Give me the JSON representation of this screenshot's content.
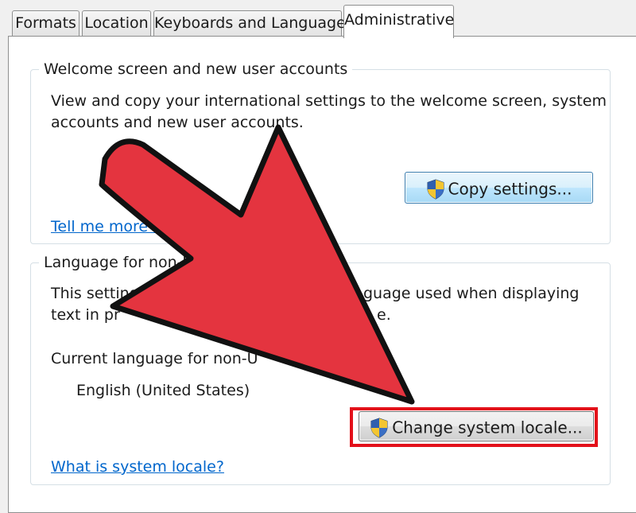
{
  "tabs": [
    {
      "label": "Formats"
    },
    {
      "label": "Location"
    },
    {
      "label": "Keyboards and Languages"
    },
    {
      "label": "Administrative",
      "active": true
    }
  ],
  "welcome_group": {
    "title": "Welcome screen and new user accounts",
    "description_line1": "View and copy your international settings to the welcome screen, system",
    "description_line2": "accounts and new user accounts.",
    "copy_button": "Copy settings...",
    "link": "Tell me more a"
  },
  "nonunicode_group": {
    "title": "Language for non-Uni",
    "setting_part1": "This setting (",
    "setting_part2": "guage used when displaying",
    "setting_line2_part1": "text in pr",
    "setting_line2_part2": "e.",
    "current_label": "Current language for non-U",
    "current_value": "English (United States)",
    "change_button": "Change system locale...",
    "link": "What is system locale?"
  },
  "colors": {
    "arrow": "#e4343f",
    "highlight": "#e3101a",
    "link": "#0066cc"
  },
  "icons": {
    "uac": "uac-shield-icon",
    "overlay": "pointer-arrow-icon"
  }
}
